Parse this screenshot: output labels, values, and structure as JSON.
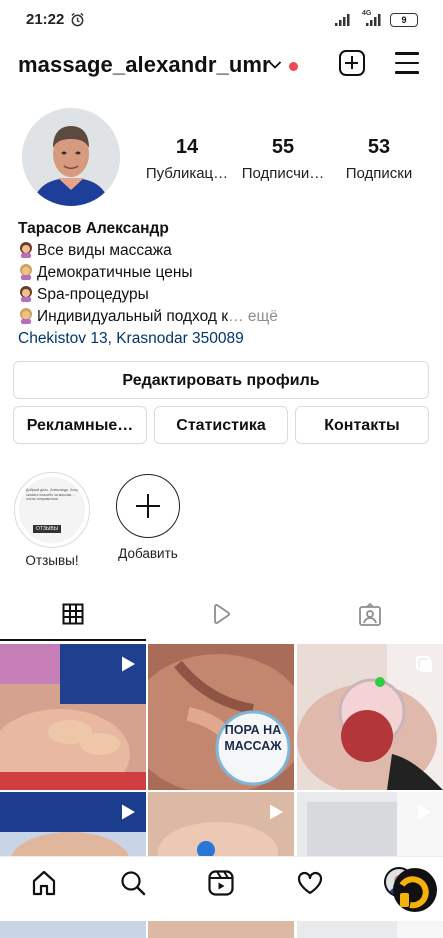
{
  "status_bar": {
    "time": "21:22",
    "battery": "9",
    "network": "4G"
  },
  "header": {
    "username": "massage_alexandr_umr",
    "icons": [
      "chevron-down-icon",
      "notification-dot",
      "new-post-icon",
      "menu-icon"
    ]
  },
  "profile": {
    "stats": [
      {
        "value": "14",
        "label": "Публикац…"
      },
      {
        "value": "55",
        "label": "Подписчи…"
      },
      {
        "value": "53",
        "label": "Подписки"
      }
    ],
    "name": "Тарасов Александр",
    "bio_lines": [
      "Все виды массажа",
      "Демократичные цены",
      "Spa-процедуры",
      "Индивидуальный подход к"
    ],
    "more": "… ещё",
    "address": "Chekistov 13, Krasnodar 350089"
  },
  "buttons": {
    "edit_profile": "Редактировать профиль",
    "ads": "Рекламные…",
    "stats": "Статистика",
    "contacts": "Контакты"
  },
  "highlights": [
    {
      "label": "Отзывы!",
      "cover_text": "Добрый день, Александр. Хочу сказать спасибо за массаж… очень понравилось",
      "cover_tag": "ОТЗЫВЫ"
    },
    {
      "label": "Добавить"
    }
  ],
  "tabs": [
    "grid-icon",
    "reels-icon",
    "tagged-icon"
  ],
  "grid_posts": [
    {
      "type": "reel",
      "overlay": ""
    },
    {
      "type": "post",
      "overlay": "ПОРА НА МАССАЖ"
    },
    {
      "type": "multi",
      "overlay": ""
    },
    {
      "type": "reel",
      "overlay": ""
    },
    {
      "type": "reel",
      "overlay": ""
    },
    {
      "type": "reel",
      "overlay": ""
    }
  ],
  "bottom_nav": [
    "home-icon",
    "search-icon",
    "reels-icon",
    "heart-icon",
    "profile-avatar"
  ],
  "colors": {
    "link": "#00376b",
    "notification": "#ed4956",
    "border": "#dbdbdb",
    "secondary_text": "#8e8e8e"
  }
}
